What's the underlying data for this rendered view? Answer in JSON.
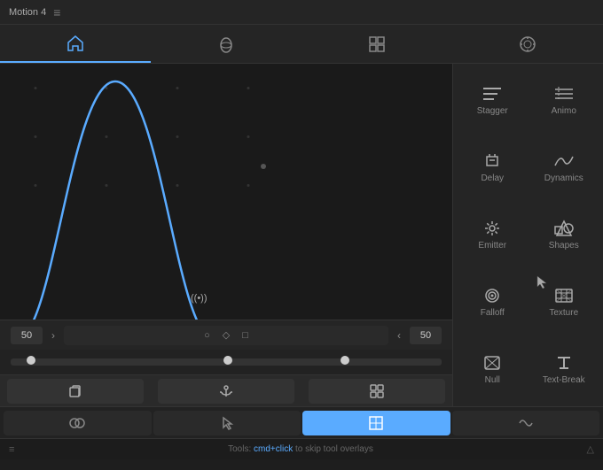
{
  "titleBar": {
    "title": "Motion 4",
    "menuIcon": "≡"
  },
  "topTabs": [
    {
      "id": "home",
      "icon": "⌂",
      "active": true
    },
    {
      "id": "shape",
      "icon": "◉",
      "active": false
    },
    {
      "id": "grid",
      "icon": "⊞",
      "active": false
    },
    {
      "id": "target",
      "icon": "◎",
      "active": false
    }
  ],
  "graph": {
    "leftValue": "50",
    "rightValue": "50",
    "curveIconLabel": "((•))"
  },
  "shapeButtons": [
    {
      "id": "circle",
      "icon": "○"
    },
    {
      "id": "diamond",
      "icon": "◇"
    },
    {
      "id": "square",
      "icon": "□"
    }
  ],
  "rightPanel": {
    "items": [
      {
        "id": "stagger",
        "label": "Stagger",
        "icon": "≡",
        "active": false
      },
      {
        "id": "animo",
        "label": "Animo",
        "icon": "≢",
        "active": false
      },
      {
        "id": "delay",
        "label": "Delay",
        "icon": "⌘",
        "active": false
      },
      {
        "id": "dynamics",
        "label": "Dynamics",
        "icon": "∿",
        "active": false
      },
      {
        "id": "emitter",
        "label": "Emitter",
        "icon": "✲",
        "active": false
      },
      {
        "id": "shapes",
        "label": "Shapes",
        "icon": "⬡",
        "active": false
      },
      {
        "id": "falloff",
        "label": "Falloff",
        "icon": "◎",
        "active": false
      },
      {
        "id": "texture",
        "label": "Texture",
        "icon": "⊞",
        "active": false
      },
      {
        "id": "null",
        "label": "Null",
        "icon": "⊡",
        "active": false
      },
      {
        "id": "text-break",
        "label": "Text-Break",
        "icon": "⊤",
        "active": false
      }
    ]
  },
  "bottomToolbar1": [
    {
      "id": "copy",
      "icon": "⧉"
    },
    {
      "id": "anchor",
      "icon": "⚓"
    },
    {
      "id": "link",
      "icon": "⊞"
    }
  ],
  "bottomTabs": [
    {
      "id": "mask",
      "icon": "◉",
      "active": false
    },
    {
      "id": "cursor",
      "icon": "⛶",
      "active": false
    },
    {
      "id": "grid2",
      "icon": "⊞",
      "active": true
    },
    {
      "id": "wave",
      "icon": "〜",
      "active": false
    }
  ],
  "statusBar": {
    "leftIcon": "≡",
    "text": "Tools: ",
    "highlight": "cmd+click",
    "textSuffix": " to skip tool overlays",
    "rightIcon": "△"
  }
}
